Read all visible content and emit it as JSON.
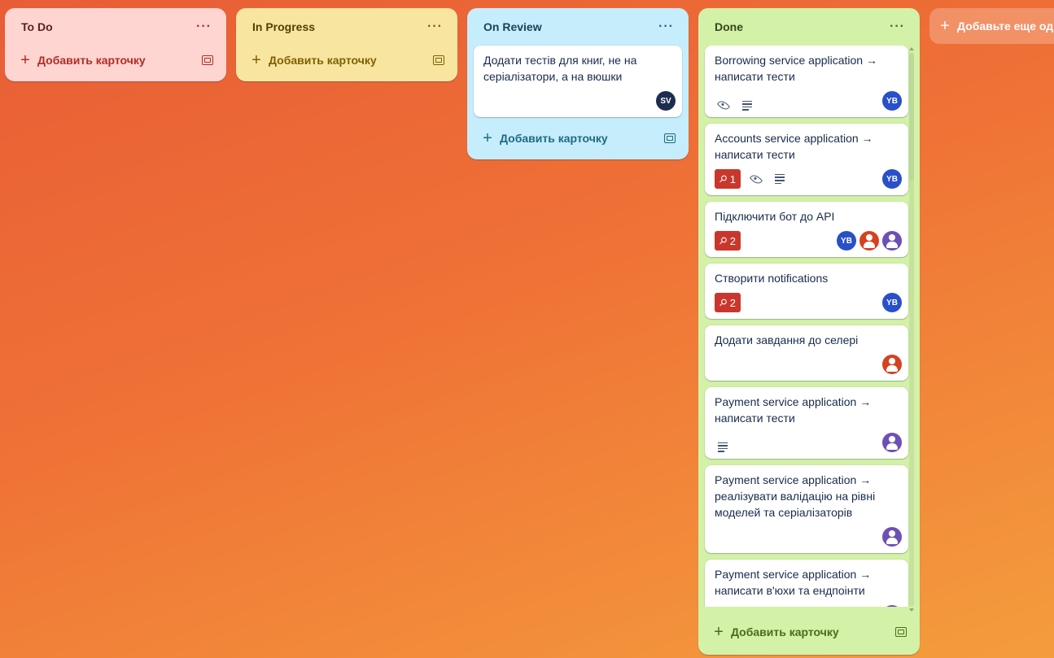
{
  "common": {
    "add_card_label": "Добавить карточку",
    "menu_dots": "···"
  },
  "lists": {
    "todo": {
      "title": "To Do"
    },
    "inprogress": {
      "title": "In Progress"
    },
    "review": {
      "title": "On Review",
      "cards": [
        {
          "title": "Додати тестів для книг, не на серіалізатори, а на вюшки",
          "member": "SV"
        }
      ]
    },
    "done": {
      "title": "Done",
      "cards": [
        {
          "title": "Borrowing service application → написати тести",
          "member": "YB"
        },
        {
          "title": "Accounts service application → написати тести",
          "pins": "1",
          "member": "YB"
        },
        {
          "title": "Підключити бот до API",
          "pins": "2",
          "member": "YB"
        },
        {
          "title": "Створити notifications",
          "pins": "2",
          "member": "YB"
        },
        {
          "title": "Додати завдання до селері"
        },
        {
          "title": "Payment service application → написати тести"
        },
        {
          "title": "Payment service application → реалізувати валідацію на рівні моделей та серіалізаторів"
        },
        {
          "title": "Payment service application → написати в'юхи та ендпоінти"
        }
      ]
    }
  },
  "add_list": {
    "label": "Добавьте еще одн"
  },
  "colors": {
    "todo_bg": "#ffd5d2",
    "inprogress_bg": "#f8e6a0",
    "review_bg": "#c6edfb",
    "done_bg": "#d3f1a7",
    "badge_red": "#c9372c",
    "avatar_blue": "#2850c8",
    "avatar_dark": "#1e2c4e"
  },
  "icons": [
    "ellipsis-icon",
    "plus-icon",
    "template-icon",
    "pin-icon",
    "eye-icon",
    "description-icon",
    "person-icon"
  ]
}
